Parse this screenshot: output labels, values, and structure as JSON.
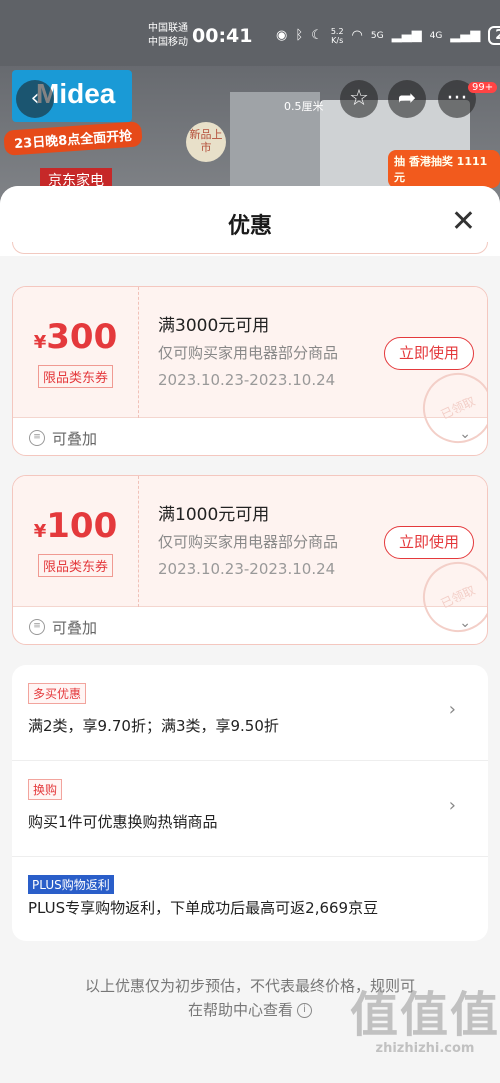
{
  "status_bar": {
    "carrier1": "中国联通",
    "carrier2": "中国移动",
    "time": "00:41",
    "speed_value": "5.2",
    "speed_unit": "K/s",
    "net1": "5G",
    "net2": "4G",
    "battery": "21"
  },
  "backdrop": {
    "brand": "Midea",
    "promo_date": "23日晚8点全面开抢",
    "new_badge": "新品上市",
    "spec": "0.5厘米",
    "lottery": "抽 香港抽奖 1111元",
    "jd_text": "京东家电",
    "cart_badge": "99+"
  },
  "sheet": {
    "title": "优惠",
    "close_icon": "close-icon"
  },
  "coupons": [
    {
      "currency": "¥",
      "amount": "300",
      "tag": "限品类东券",
      "condition": "满3000元可用",
      "scope": "仅可购买家用电器部分商品",
      "date": "2023.10.23-2023.10.24",
      "button": "立即使用",
      "stamp": "已领取",
      "stack_label": "可叠加"
    },
    {
      "currency": "¥",
      "amount": "100",
      "tag": "限品类东券",
      "condition": "满1000元可用",
      "scope": "仅可购买家用电器部分商品",
      "date": "2023.10.23-2023.10.24",
      "button": "立即使用",
      "stamp": "已领取",
      "stack_label": "可叠加"
    }
  ],
  "promotions": [
    {
      "tag": "多买优惠",
      "desc": "满2类，享9.70折；满3类，享9.50折"
    },
    {
      "tag": "换购",
      "desc": "购买1件可优惠换购热销商品"
    },
    {
      "tag": "PLUS购物返利",
      "desc": "PLUS专享购物返利，下单成功后最高可返2,669京豆"
    }
  ],
  "note": {
    "line1": "以上优惠仅为初步预估，不代表最终价格，规则可",
    "line2": "在帮助中心查看"
  },
  "watermark": {
    "mark": "值值值",
    "site": "zhizhizhi.com"
  },
  "colors": {
    "accent": "#e4393c",
    "plus_blue": "#2a5ec9"
  }
}
